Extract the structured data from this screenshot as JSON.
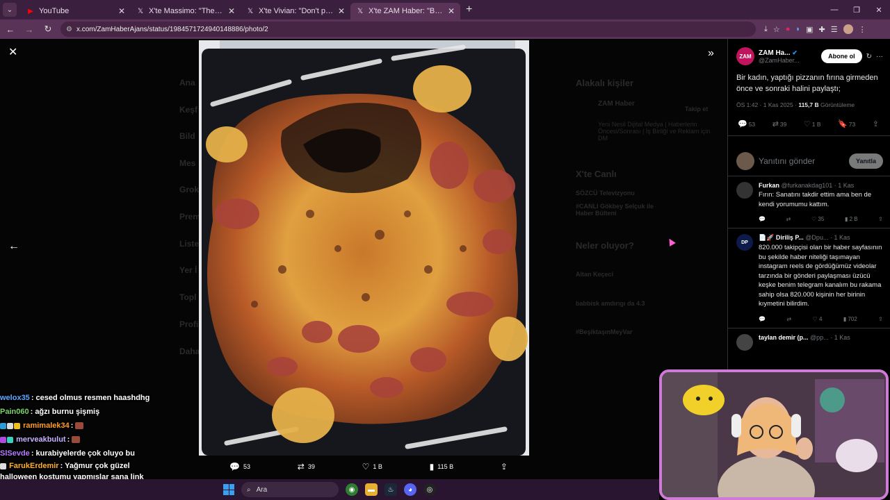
{
  "browser": {
    "tabs": [
      {
        "label": "YouTube",
        "icon": "youtube-icon",
        "active": false
      },
      {
        "label": "X'te Massimo: \"The perfect Hal",
        "icon": "x-icon",
        "active": false
      },
      {
        "label": "X'te Vivian: \"Don't pop the ball",
        "icon": "x-icon",
        "active": false
      },
      {
        "label": "X'te ZAM Haber: \"Bir kadın, yap",
        "icon": "x-icon",
        "active": true
      }
    ],
    "url": "x.com/ZamHaberAjans/status/1984571724940148886/photo/2"
  },
  "background_faded": {
    "sidebar": [
      "Ana",
      "Keşf",
      "Bild",
      "Mes",
      "Grok",
      "Prem",
      "Liste",
      "Yer İ",
      "Topl",
      "Profi",
      "Daha"
    ],
    "right": [
      "Alakalı kişiler",
      "ZAM Haber",
      "Takip et",
      "Yeni Nesil Dijital Medya | Haberlerin Öncesi/Sonrası | İş Birliği ve Reklam için DM",
      "X'te Canlı",
      "SÖZCÜ Televizyonu",
      "#CANLI Gökbey Selçuk ile Haber Bülteni",
      "Neler oluyor?",
      "Altan Keçeci",
      "babbisk amdırıgı da 4.3",
      "#BeşiktaşınMeyVar"
    ]
  },
  "viewer": {
    "actions": [
      {
        "icon": "reply-icon",
        "count": "53"
      },
      {
        "icon": "repost-icon",
        "count": "39"
      },
      {
        "icon": "like-icon",
        "count": "1 B"
      },
      {
        "icon": "views-icon",
        "count": "115 B"
      },
      {
        "icon": "share-icon",
        "count": ""
      }
    ]
  },
  "tweet": {
    "logo_text": "ZAM",
    "name": "ZAM Ha...",
    "handle": "@ZamHaber...",
    "follow_label": "Abone ol",
    "text": "Bir kadın, yaptığı pizzanın fırına girmeden önce ve sonraki halini paylaştı;",
    "time": "ÖS 1:42 · 1 Kas 2025 · ",
    "views_count": "115,7 B",
    "views_label": " Görüntüleme",
    "stats": {
      "replies": "53",
      "reposts": "39",
      "likes": "1 B",
      "bookmarks": "73"
    },
    "reply_placeholder": "Yanıtını gönder",
    "reply_button": "Yanıtla"
  },
  "comments": [
    {
      "name": "Furkan",
      "handle": "@furkanakdag101 · 1 Kas",
      "avatar_text": "",
      "avatar_color": "#333",
      "text": "Fırın: Sanatını takdir ettim ama ben de kendi yorumumu kattım.",
      "replies": "",
      "reposts": "",
      "likes": "35",
      "views": "2 B"
    },
    {
      "name": "📄🚀 Diriliş P...",
      "handle": "@Dpu... · 1 Kas",
      "avatar_text": "DP",
      "avatar_color": "#0d1b4a",
      "text": "820.000 takipçisi olan bir haber sayfasının bu şekilde haber niteliği taşımayan instagram reels de gördüğümüz videolar tarzında bir gönderi paylaşması üzücü keşke benim telegram kanalım bu rakama sahip olsa 820.000 kişinin her birinin kıymetini bilirdim.",
      "replies": "",
      "reposts": "",
      "likes": "4",
      "views": "702"
    },
    {
      "name": "taylan demir (p...",
      "handle": "@pp... · 1 Kas",
      "avatar_text": "",
      "avatar_color": "#444",
      "text": "",
      "replies": "",
      "reposts": "",
      "likes": "",
      "views": ""
    }
  ],
  "chat": [
    {
      "user": "welox35",
      "color": "#5ea8ff",
      "text": ": cesed olmus resmen haashdhg"
    },
    {
      "user": "Pain060",
      "color": "#7cd36a",
      "text": ": ağzı burnu şişmiş"
    },
    {
      "user": "ramimalek34",
      "color": "#ff9d2a",
      "text": ": "
    },
    {
      "user": "merveakbulut",
      "color": "#c6b3ff",
      "text": ": "
    },
    {
      "user": "SlSevde",
      "color": "#b57cff",
      "text": ": kurabiyelerde çok oluyo bu"
    },
    {
      "user": "FarukErdemir",
      "color": "#ffb02e",
      "text": ": Yağmur çok güzel halloween kostumu yapmışlar sana link atıyorum"
    }
  ],
  "taskbar": {
    "search_label": "Ara"
  }
}
